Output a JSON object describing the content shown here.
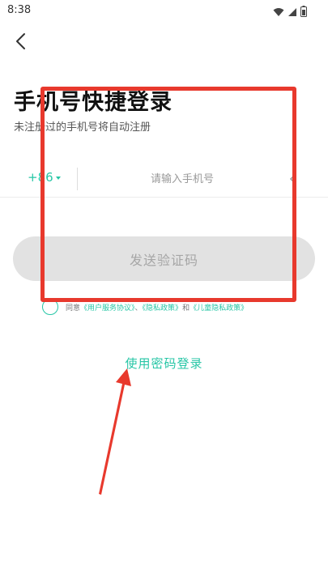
{
  "status_bar": {
    "time": "8:38",
    "icons": [
      "wifi-icon",
      "signal-icon",
      "battery-icon"
    ]
  },
  "header": {
    "back_icon": "chevron-left-icon"
  },
  "title": "手机号快捷登录",
  "subtitle": "未注册过的手机号将自动注册",
  "phone": {
    "country_code": "+86",
    "placeholder": "请输入手机号",
    "value": ""
  },
  "send_code_label": "发送验证码",
  "agreement": {
    "prefix": "同意",
    "user_agreement": "《用户服务协议》",
    "sep1": "、",
    "privacy_policy": "《隐私政策》",
    "and": "和",
    "child_policy": "《儿童隐私政策》"
  },
  "password_login_label": "使用密码登录",
  "colors": {
    "accent": "#27c6a6",
    "annotation": "#e8392d",
    "button_disabled_bg": "#e2e2e2",
    "button_disabled_text": "#a6a6a6"
  }
}
